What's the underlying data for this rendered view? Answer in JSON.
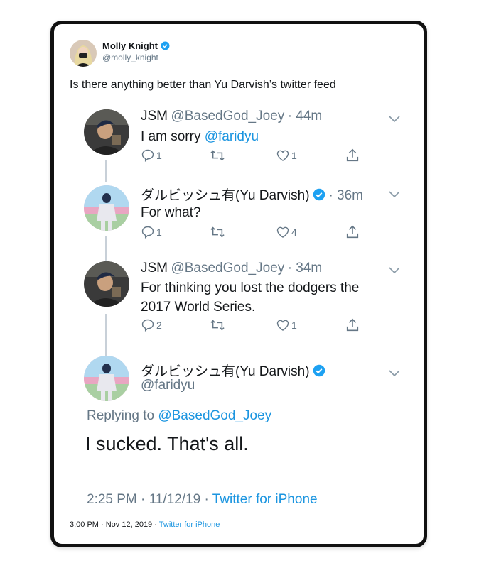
{
  "outer": {
    "author_name": "Molly Knight",
    "author_handle": "@molly_knight",
    "tweet_text": "Is there anything better than Yu Darvish’s twitter feed",
    "timestamp": "3:00 PM · Nov 12, 2019 · ",
    "source": "Twitter for iPhone"
  },
  "thread": [
    {
      "name": "JSM",
      "handle": "@BasedGod_Joey",
      "time": "· 44m",
      "text": "I am sorry ",
      "mention": "@faridyu",
      "replies": "1",
      "retweets": "",
      "likes": "1",
      "verified": false
    },
    {
      "name": "ダルビッシュ有(Yu Darvish)",
      "handle": "",
      "time": "· 36m",
      "text": "For what?",
      "replies": "1",
      "retweets": "",
      "likes": "4",
      "verified": true
    },
    {
      "name": "JSM",
      "handle": "@BasedGod_Joey",
      "time": "· 34m",
      "text_line1": "For thinking you lost the dodgers the",
      "text_line2": "2017 World Series.",
      "replies": "2",
      "retweets": "",
      "likes": "1",
      "verified": false
    }
  ],
  "final_reply": {
    "name": "ダルビッシュ有(Yu Darvish)",
    "handle": "@faridyu",
    "replying_prefix": "Replying to ",
    "replying_to": "@BasedGod_Joey",
    "text": "I sucked. That's all.",
    "timestamp": "2:25 PM · 11/12/19 · ",
    "source": "Twitter for iPhone"
  },
  "colors": {
    "link": "#1b95e0",
    "muted": "#657786",
    "verified": "#1da1f2"
  }
}
